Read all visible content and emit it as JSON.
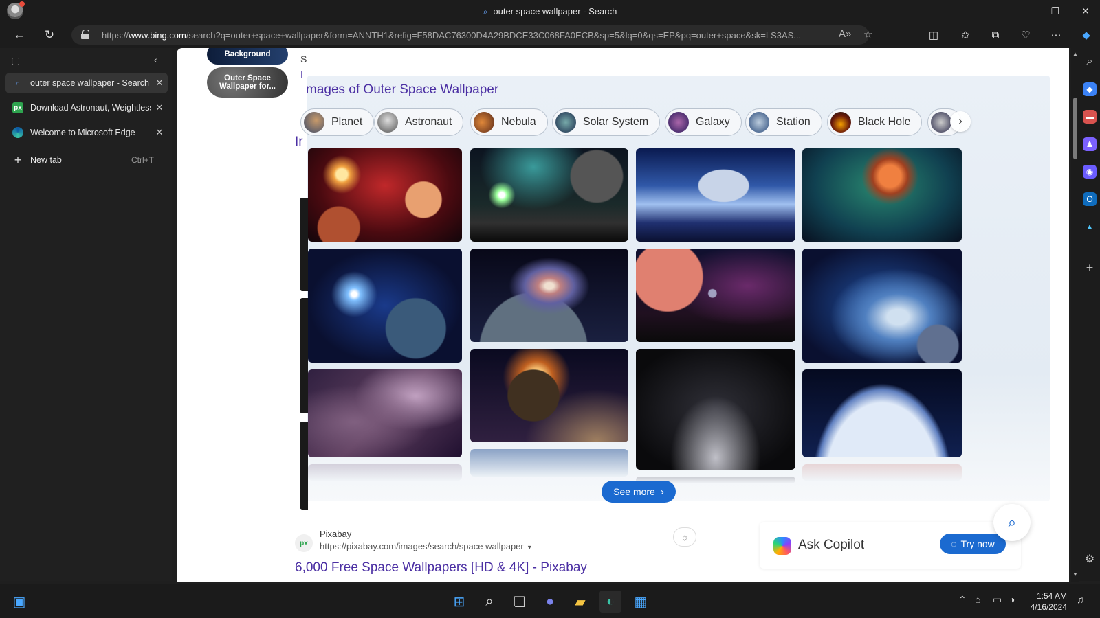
{
  "window": {
    "title": "outer space wallpaper - Search",
    "controls": {
      "minimize": "—",
      "restore": "❐",
      "close": "✕"
    }
  },
  "address_bar": {
    "url_prefix": "https://",
    "url_domain": "www.bing.com",
    "url_rest": "/search?q=outer+space+wallpaper&form=ANNTH1&refig=F58DAC76300D4A29BDCE33C068FA0ECB&sp=5&lq=0&qs=EP&pq=outer+space&sk=LS3AS..."
  },
  "tabs": [
    {
      "label": "outer space wallpaper - Search",
      "active": true,
      "favicon": "search-icon"
    },
    {
      "label": "Download Astronaut, Weightless",
      "active": false,
      "favicon": "px"
    },
    {
      "label": "Welcome to Microsoft Edge",
      "active": false,
      "favicon": "edge-icon"
    }
  ],
  "new_tab": {
    "label": "New tab",
    "shortcut": "Ctrl+T"
  },
  "left_card": {
    "pill_1": "Background",
    "pill_2": "Outer Space Wallpaper for..."
  },
  "section_title": "mages of Outer Space Wallpaper",
  "partial_letters": {
    "s": "S",
    "l": "I",
    "ir": "Ir"
  },
  "chips": [
    {
      "label": "Planet",
      "colors": [
        "#3a4a6a",
        "#c89a6a"
      ]
    },
    {
      "label": "Astronaut",
      "colors": [
        "#555",
        "#ddd"
      ]
    },
    {
      "label": "Nebula",
      "colors": [
        "#5a2a1a",
        "#e0883a"
      ]
    },
    {
      "label": "Solar System",
      "colors": [
        "#1a2a4a",
        "#7aa"
      ]
    },
    {
      "label": "Galaxy",
      "colors": [
        "#2a1a5a",
        "#a6a"
      ]
    },
    {
      "label": "Station",
      "colors": [
        "#2a4a7a",
        "#bcd"
      ]
    },
    {
      "label": "Black Hole",
      "colors": [
        "#6a1a0a",
        "#f5a000"
      ]
    }
  ],
  "see_more": "See more",
  "result": {
    "site": "Pixabay",
    "url": "https://pixabay.com/images/search/space wallpaper",
    "title": "6,000 Free Space Wallpapers [HD & 4K] - Pixabay",
    "favicon_text": "px"
  },
  "copilot": {
    "label": "Ask Copilot",
    "button": "Try now"
  },
  "taskbar": {
    "time": "1:54 AM",
    "date": "4/16/2024"
  }
}
